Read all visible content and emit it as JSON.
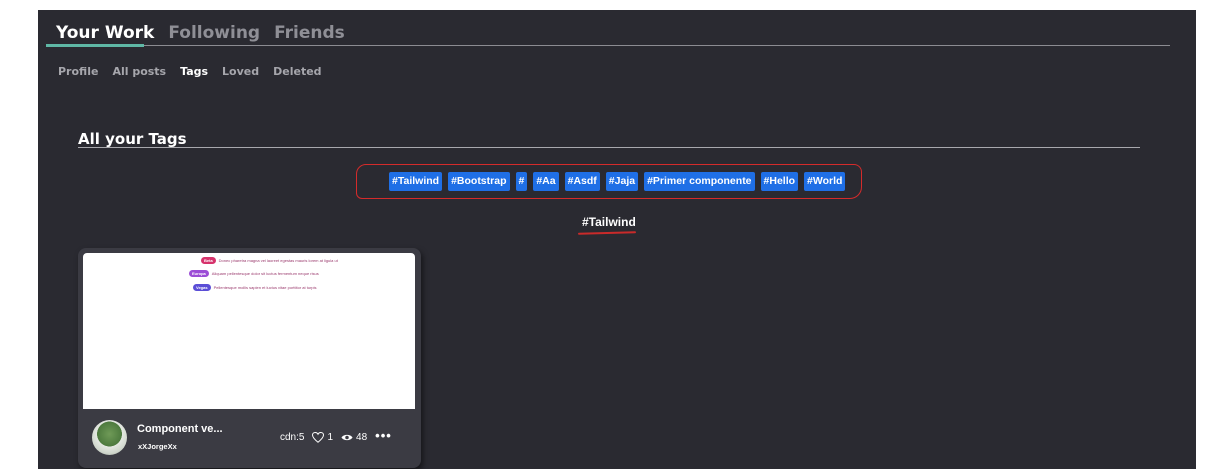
{
  "top_tabs": [
    {
      "label": "Your Work"
    },
    {
      "label": "Following"
    },
    {
      "label": "Friends"
    }
  ],
  "sub_tabs": [
    {
      "label": "Profile"
    },
    {
      "label": "All posts"
    },
    {
      "label": "Tags"
    },
    {
      "label": "Loved"
    },
    {
      "label": "Deleted"
    }
  ],
  "section": {
    "title": "All your Tags"
  },
  "tags": [
    {
      "label": "#Tailwind"
    },
    {
      "label": "#Bootstrap"
    },
    {
      "label": "#"
    },
    {
      "label": "#Aa"
    },
    {
      "label": "#Asdf"
    },
    {
      "label": "#Jaja"
    },
    {
      "label": "#Primer componente"
    },
    {
      "label": "#Hello"
    },
    {
      "label": "#World"
    }
  ],
  "selected_tag": "#Tailwind",
  "card": {
    "title": "Component ve...",
    "author": "xXJorgeXx",
    "cdn": "cdn:5",
    "likes": "1",
    "views": "48",
    "more": "•••",
    "preview_rows": [
      {
        "badge": "Beta",
        "text": "Donec pharetra magna vel laoreet egestas mauris lorem at ligula ut",
        "badge_color": "#d6336c"
      },
      {
        "badge": "Europa",
        "text": "Aliquam pellentesque dolor sit luctus fermentum neque risus",
        "badge_color": "#9b4dd6"
      },
      {
        "badge": "Vegas",
        "text": "Pellentesque mollis sapien et luctus vitae porttitor at turpis",
        "badge_color": "#5b4ed6"
      }
    ]
  },
  "colors": {
    "background": "#2a2a31",
    "accent": "#5fb8a6",
    "tag": "#1f6fe6",
    "annotation": "#d42b2b"
  }
}
